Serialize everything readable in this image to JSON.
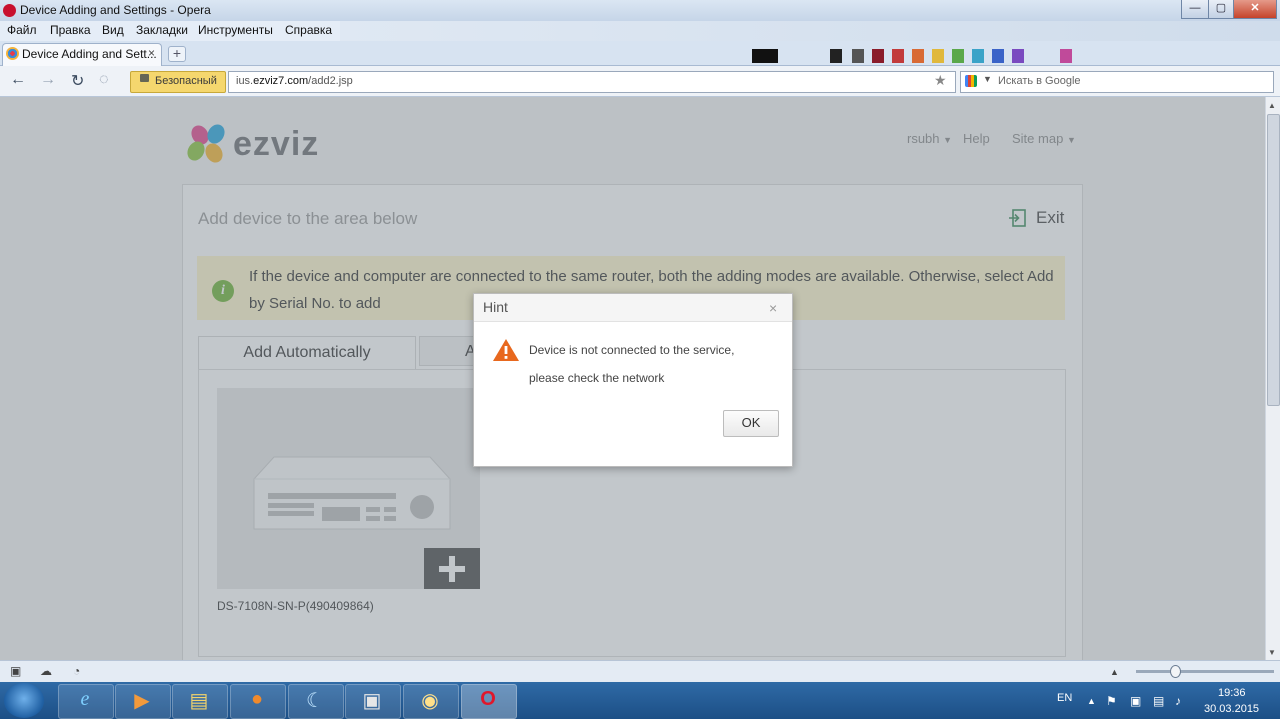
{
  "window": {
    "title": "Device Adding and Settings - Opera",
    "controls": {
      "minimize": "—",
      "maximize": "▢",
      "close": "✕"
    }
  },
  "menu": [
    "Файл",
    "Правка",
    "Вид",
    "Закладки",
    "Инструменты",
    "Справка"
  ],
  "tab": {
    "label": "Device Adding and Sett...",
    "close": "×",
    "newtab": "+"
  },
  "addressbar": {
    "security_label": "Безопасный",
    "url_prefix": "ius.",
    "url_domain": "ezviz7.com",
    "url_path": "/add2.jsp",
    "search_placeholder": "Искать в Google"
  },
  "site": {
    "logo_text": "ezviz",
    "user": "rsubh",
    "help": "Help",
    "sitemap": "Site map"
  },
  "panel": {
    "title": "Add device to the area below",
    "exit": "Exit",
    "notice": "If the device and computer are connected to the same router, both the adding modes are available. Otherwise, select Add by Serial No. to add",
    "tabs": [
      "Add Automatically",
      "A"
    ],
    "device_label": "DS-7108N-SN-P(490409864)"
  },
  "dialog": {
    "title": "Hint",
    "close": "×",
    "message_line1": "Device is not connected to the service,",
    "message_line2": "please check the network",
    "ok": "OK"
  },
  "taskbar": {
    "language": "EN",
    "time": "19:36",
    "date": "30.03.2015"
  },
  "colors": {
    "notice_bg": "#fff6cc",
    "info_green": "#6fb536",
    "warning_orange": "#e8681e",
    "opera_red": "#c8102e"
  }
}
